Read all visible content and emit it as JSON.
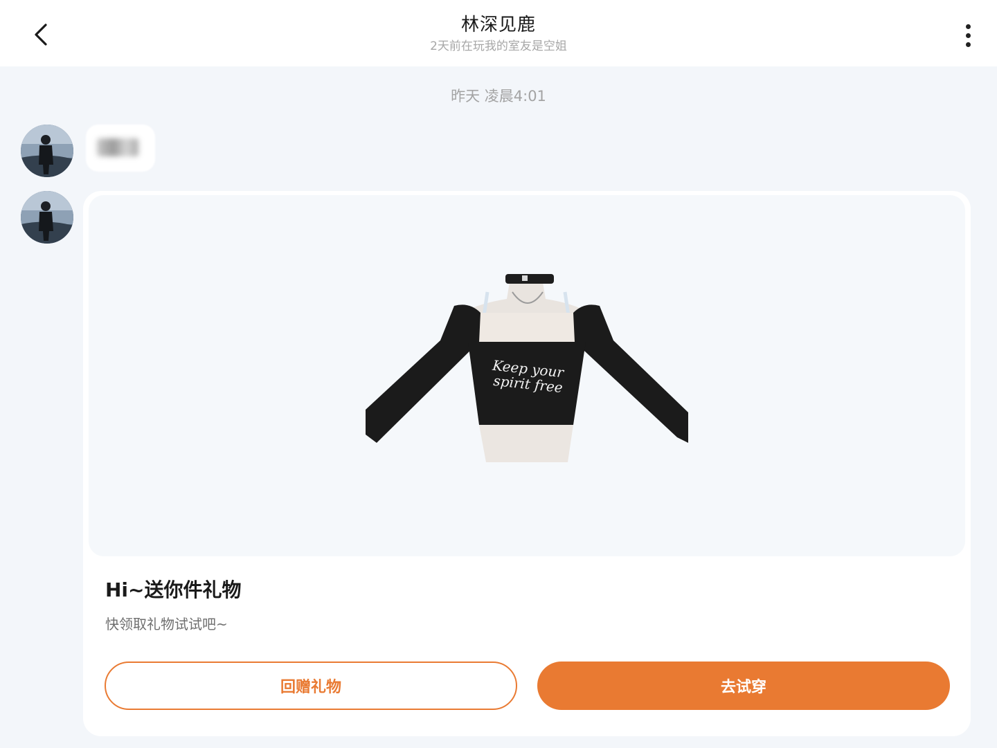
{
  "header": {
    "title": "林深见鹿",
    "subtitle": "2天前在玩我的室友是空姐",
    "back_icon": "chevron-left-icon",
    "more_icon": "more-vertical-icon"
  },
  "chat": {
    "timestamp": "昨天 凌晨4:01",
    "gift_card": {
      "title": "Hi~送你件礼物",
      "description": "快领取礼物试试吧~",
      "shirt_text": "Keep your spirit free",
      "return_button_label": "回赠礼物",
      "try_button_label": "去试穿"
    }
  },
  "colors": {
    "accent": "#e97a32",
    "background": "#f3f6fa"
  }
}
